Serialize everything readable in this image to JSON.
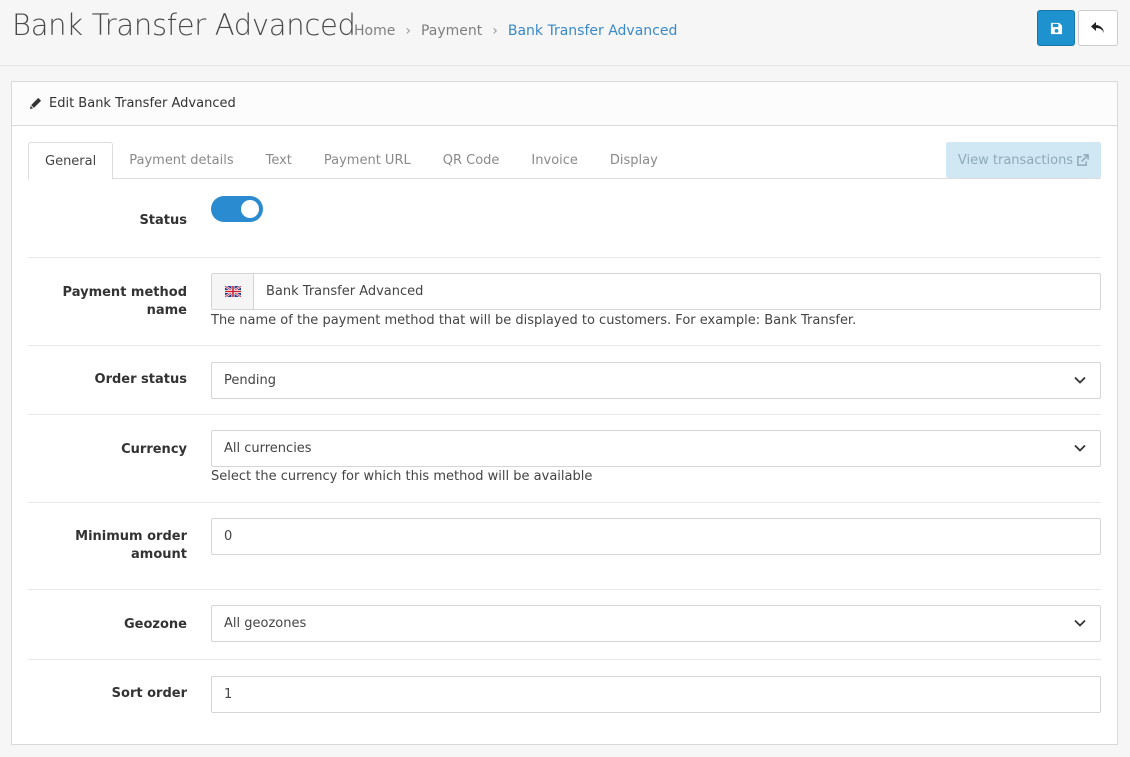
{
  "header": {
    "title": "Bank Transfer Advanced",
    "breadcrumb": [
      "Home",
      "Payment",
      "Bank Transfer Advanced"
    ]
  },
  "panel": {
    "heading": "Edit Bank Transfer Advanced"
  },
  "tabs": [
    {
      "label": "General",
      "active": true
    },
    {
      "label": "Payment details"
    },
    {
      "label": "Text"
    },
    {
      "label": "Payment URL"
    },
    {
      "label": "QR Code"
    },
    {
      "label": "Invoice"
    },
    {
      "label": "Display"
    }
  ],
  "view_transactions": "View transactions",
  "form": {
    "status": {
      "label": "Status",
      "enabled": true
    },
    "name": {
      "label": "Payment method name",
      "value": "Bank Transfer Advanced",
      "help": "The name of the payment method that will be displayed to customers. For example: Bank Transfer."
    },
    "order_status": {
      "label": "Order status",
      "value": "Pending"
    },
    "currency": {
      "label": "Currency",
      "value": "All currencies",
      "help": "Select the currency for which this method will be available"
    },
    "min_order": {
      "label_line1": "Minimum order",
      "label_line2": "amount",
      "value": "0"
    },
    "geozone": {
      "label": "Geozone",
      "value": "All geozones"
    },
    "sort_order": {
      "label": "Sort order",
      "value": "1"
    }
  },
  "colors": {
    "primary": "#1e91cf",
    "toggle": "#2a8bd0",
    "breadcrumb_active": "#3a89c9"
  }
}
